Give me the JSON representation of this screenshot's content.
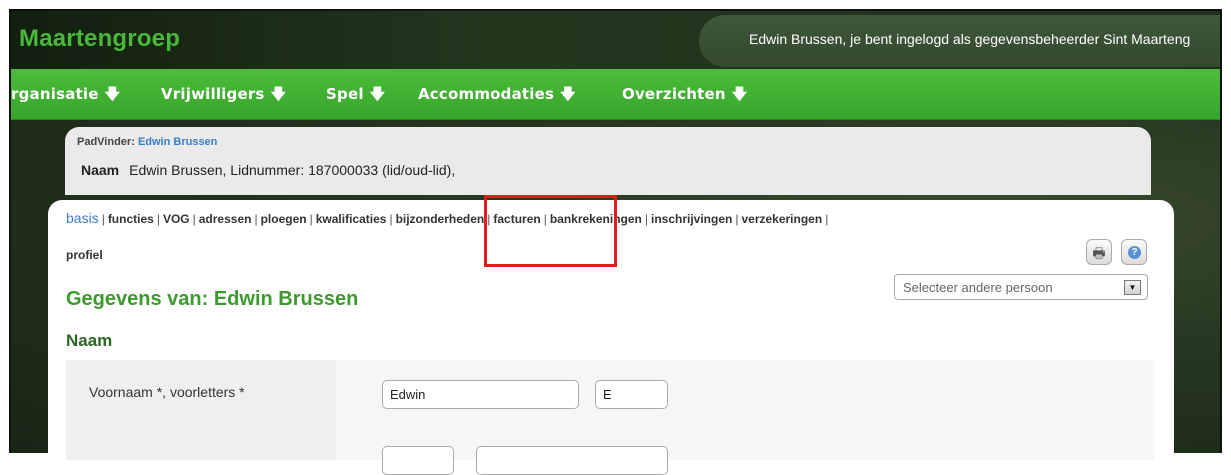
{
  "header": {
    "logo": "Maartengroep",
    "login_text": "Edwin Brussen, je bent ingelogd als gegevensbeheerder Sint Maarteng"
  },
  "nav": [
    {
      "label": "rganisatie"
    },
    {
      "label": "Vrijwilligers"
    },
    {
      "label": "Spel"
    },
    {
      "label": "Accommodaties"
    },
    {
      "label": "Overzichten"
    }
  ],
  "breadcrumb": {
    "prefix": "PadVinder:",
    "link": "Edwin Brussen"
  },
  "naam": {
    "label": "Naam",
    "value": "Edwin Brussen, Lidnummer: 187000033 (lid/oud-lid),"
  },
  "tabs": [
    "basis",
    "functies",
    "VOG",
    "adressen",
    "ploegen",
    "kwalificaties",
    "bijzonderheden",
    "facturen",
    "bankrekeningen",
    "inschrijvingen",
    "verzekeringen"
  ],
  "tab_profiel": "profiel",
  "select": {
    "placeholder": "Selecteer andere persoon"
  },
  "heading": "Gegevens van: Edwin Brussen",
  "section": "Naam",
  "form": {
    "label": "Voornaam *, voorletters *",
    "voornaam": "Edwin",
    "voorletters": "E"
  },
  "icons": {
    "print": "printer-icon",
    "help": "help-icon",
    "nav_arrow": "down-arrow-icon"
  },
  "colors": {
    "accent_green": "#3d9a2e",
    "nav_green": "#42b232",
    "link_blue": "#3a7dc8",
    "highlight_red": "#e21b1b"
  }
}
